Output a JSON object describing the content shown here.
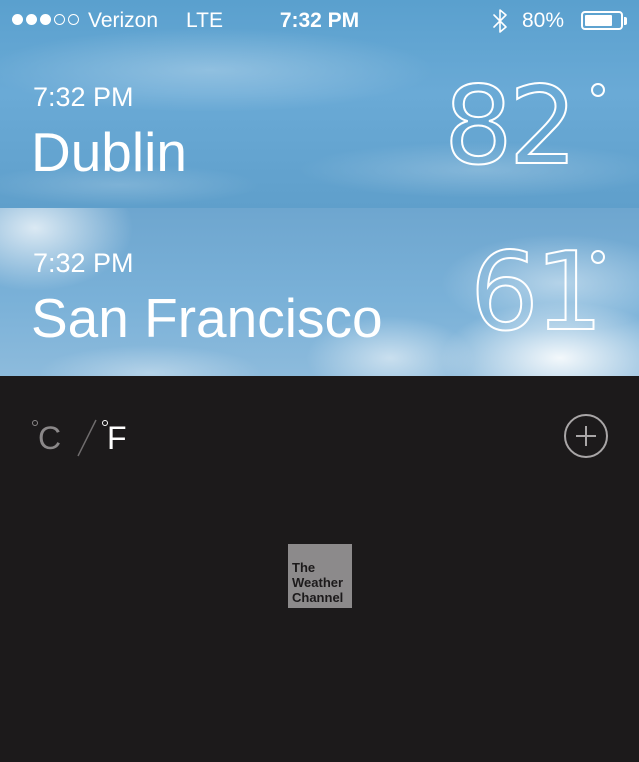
{
  "status_bar": {
    "carrier": "Verizon",
    "network": "LTE",
    "time": "7:32 PM",
    "battery_percent": "80%",
    "battery_level": 0.8,
    "signal_bars_filled": 3,
    "signal_bars_total": 5
  },
  "cities": [
    {
      "time": "7:32 PM",
      "name": "Dublin",
      "temperature": "82"
    },
    {
      "time": "7:32 PM",
      "name": "San Francisco",
      "temperature": "61"
    }
  ],
  "units": {
    "celsius": "C",
    "fahrenheit": "F",
    "selected": "F"
  },
  "logo": {
    "line1": "The",
    "line2": "Weather",
    "line3": "Channel"
  },
  "icons": {
    "bluetooth": "bluetooth-icon",
    "battery": "battery-icon",
    "add": "plus-circle-icon",
    "signal": "signal-dots-icon"
  }
}
